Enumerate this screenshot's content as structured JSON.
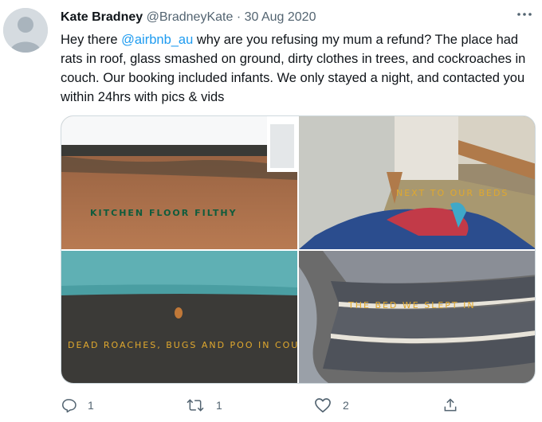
{
  "tweet": {
    "author_name": "Kate Bradney",
    "handle": "@BradneyKate",
    "separator": "·",
    "date": "30 Aug 2020",
    "more": "•••",
    "text_before": "Hey there ",
    "mention": "@airbnb_au",
    "text_after": " why are you refusing my mum a refund? The place had rats in roof, glass smashed on ground, dirty clothes in trees, and cockroaches in couch. Our booking included infants. We only stayed a night, and contacted you within 24hrs with pics & vids"
  },
  "photos": {
    "top_left_caption": "KITCHEN FLOOR FILTHY",
    "top_right_caption": "NEXT TO OUR BEDS",
    "bottom_left_caption": "DEAD ROACHES, BUGS AND POO IN COUCH",
    "bottom_right_caption": "THE BED WE SLEPT IN"
  },
  "actions": {
    "reply_count": "1",
    "retweet_count": "1",
    "like_count": "2"
  },
  "colors": {
    "link": "#1d9bf0",
    "icon": "#536471",
    "caption_green": "#0f5c3c",
    "caption_gold": "#e0a82e"
  },
  "icons": [
    "avatar-default",
    "more-icon",
    "reply-icon",
    "retweet-icon",
    "like-icon",
    "share-icon"
  ]
}
